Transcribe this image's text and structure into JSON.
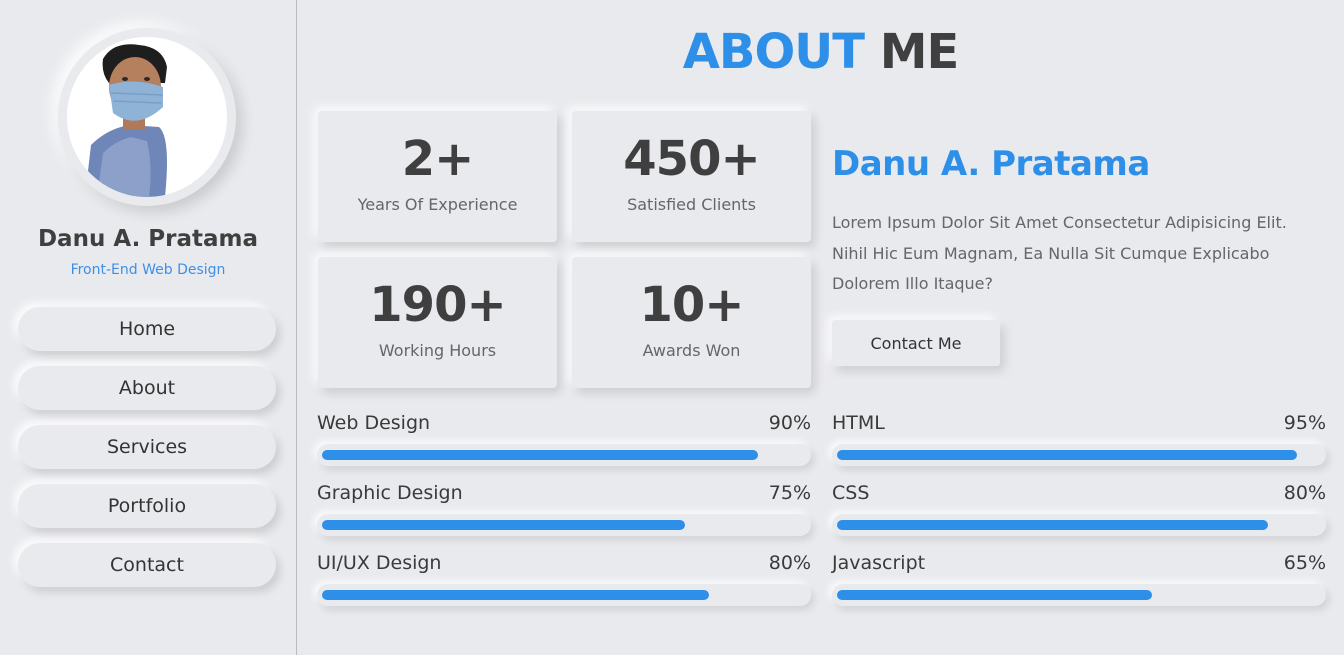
{
  "sidebar": {
    "profile": {
      "name": "Danu A. Pratama",
      "role": "Front-End Web Design",
      "avatar_icon": "profile-photo"
    },
    "nav": [
      {
        "label": "Home"
      },
      {
        "label": "About"
      },
      {
        "label": "Services"
      },
      {
        "label": "Portfolio"
      },
      {
        "label": "Contact"
      }
    ]
  },
  "main": {
    "title_highlight": "ABOUT",
    "title_rest": "ME",
    "stats": [
      {
        "value": "2+",
        "label": "Years Of Experience"
      },
      {
        "value": "450+",
        "label": "Satisfied Clients"
      },
      {
        "value": "190+",
        "label": "Working Hours"
      },
      {
        "value": "10+",
        "label": "Awards Won"
      }
    ],
    "about": {
      "name": "Danu A. Pratama",
      "text": "Lorem Ipsum Dolor Sit Amet Consectetur Adipisicing Elit. Nihil Hic Eum Magnam, Ea Nulla Sit Cumque Explicabo Dolorem Illo Itaque?",
      "contact_label": "Contact Me"
    },
    "skills": [
      {
        "name": "Web Design",
        "percent_label": "90%",
        "level": 0.9
      },
      {
        "name": "Graphic Design",
        "percent_label": "75%",
        "level": 0.75
      },
      {
        "name": "UI/UX Design",
        "percent_label": "80%",
        "level": 0.8
      },
      {
        "name": "HTML",
        "percent_label": "95%",
        "level": 0.95
      },
      {
        "name": "CSS",
        "percent_label": "80%",
        "level": 0.89
      },
      {
        "name": "Javascript",
        "percent_label": "65%",
        "level": 0.65
      }
    ]
  },
  "colors": {
    "accent": "#2e8fe8",
    "background": "#e9eaee",
    "text_dark": "#3f3f3f"
  }
}
